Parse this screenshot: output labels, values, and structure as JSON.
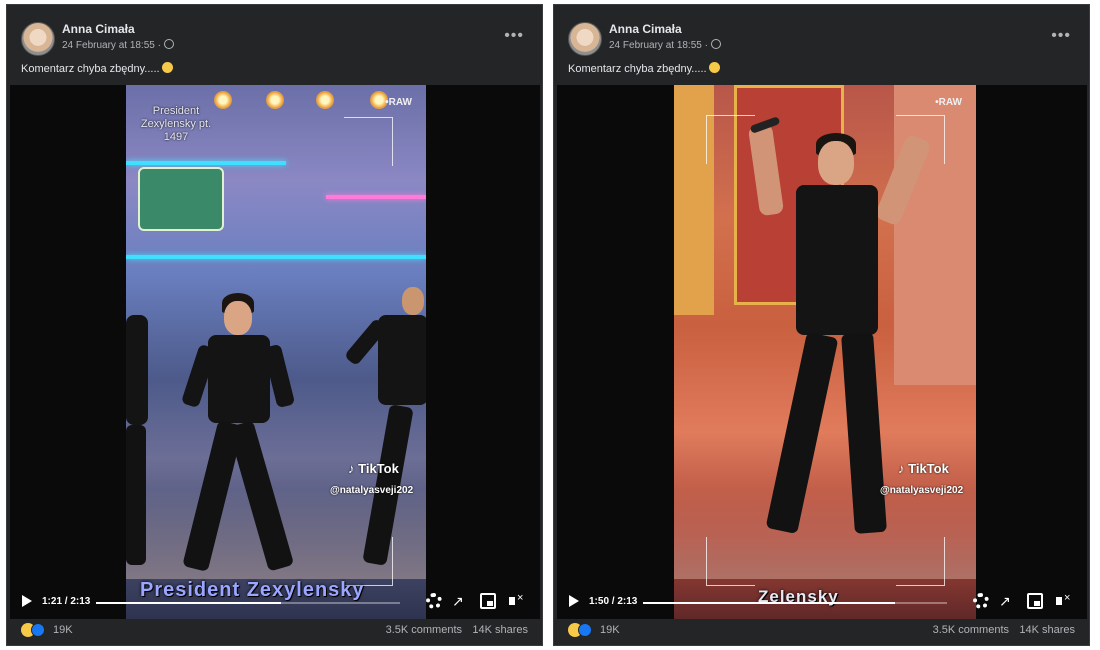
{
  "posts": [
    {
      "author": "Anna Cimała",
      "timestamp": "24 February at 18:55 ·",
      "caption": "Komentarz chyba zbędny.....",
      "video": {
        "overlay_title": "President Zexylensky pt. 1497",
        "raw_label": "•RAW",
        "tiktok_brand": "TikTok",
        "tiktok_user": "@natalyasveji202",
        "subtitle": "President Zexylensky",
        "time": "1:21 / 2:13",
        "progress": 0.61
      },
      "reactions_count": "19K",
      "comments": "3.5K comments",
      "shares": "14K shares"
    },
    {
      "author": "Anna Cimała",
      "timestamp": "24 February at 18:55 ·",
      "caption": "Komentarz chyba zbędny.....",
      "video": {
        "raw_label": "•RAW",
        "tiktok_brand": "TikTok",
        "tiktok_user": "@natalyasveji202",
        "subtitle": "Zelensky",
        "time": "1:50 / 2:13",
        "progress": 0.83
      },
      "reactions_count": "19K",
      "comments": "3.5K comments",
      "shares": "14K shares"
    }
  ],
  "icons": {
    "more": "more-horizontal-icon",
    "play": "play-icon",
    "settings": "gear-icon",
    "fullscreen": "expand-icon",
    "pip": "picture-in-picture-icon",
    "volume": "mute-icon"
  }
}
